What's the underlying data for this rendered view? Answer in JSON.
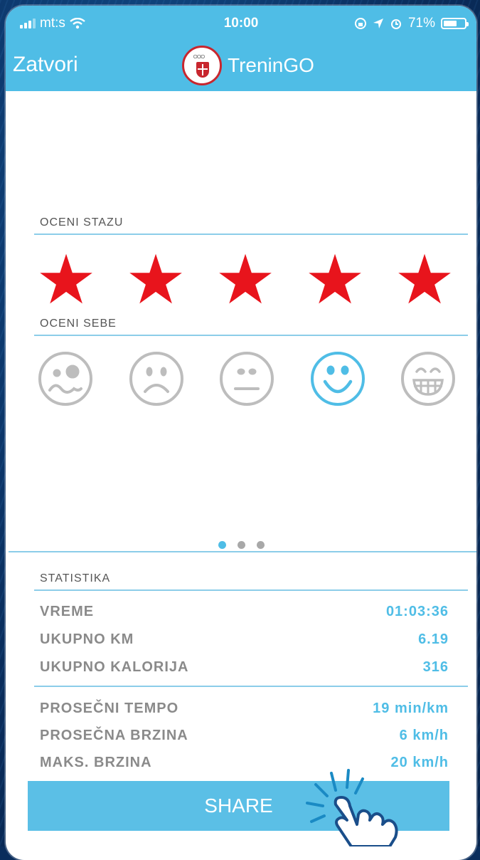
{
  "status_bar": {
    "carrier": "mt:s",
    "time": "10:00",
    "battery": "71%",
    "battery_level": 0.71
  },
  "nav": {
    "close_label": "Zatvori",
    "title": "TreninGO"
  },
  "rate_track": {
    "label": "OCENI STAZU",
    "stars_total": 5,
    "stars_filled": 5,
    "star_glyph": "★",
    "star_color": "#e8141c"
  },
  "rate_self": {
    "label": "OCENI SEBE",
    "faces": [
      "sick-face",
      "sad-face",
      "neutral-face",
      "happy-face",
      "grin-face"
    ],
    "selected": "happy-face",
    "selected_color": "#4fbde6",
    "unselected_color": "#bdbdbd"
  },
  "pager": {
    "pages": 3,
    "active": 1
  },
  "stats": {
    "title": "STATISTIKA",
    "group1": [
      {
        "label": "VREME",
        "value": "01:03:36"
      },
      {
        "label": "UKUPNO KM",
        "value": "6.19"
      },
      {
        "label": "UKUPNO KALORIJA",
        "value": "316"
      }
    ],
    "group2": [
      {
        "label": "PROSEČNI TEMPO",
        "value": "19 min/km"
      },
      {
        "label": "PROSEČNA BRZINA",
        "value": "6 km/h"
      },
      {
        "label": "MAKS. BRZINA",
        "value": "20 km/h"
      }
    ]
  },
  "share_label": "SHARE",
  "colors": {
    "accent": "#4fbde6",
    "star": "#e8141c",
    "background": "#0a2d5c"
  }
}
